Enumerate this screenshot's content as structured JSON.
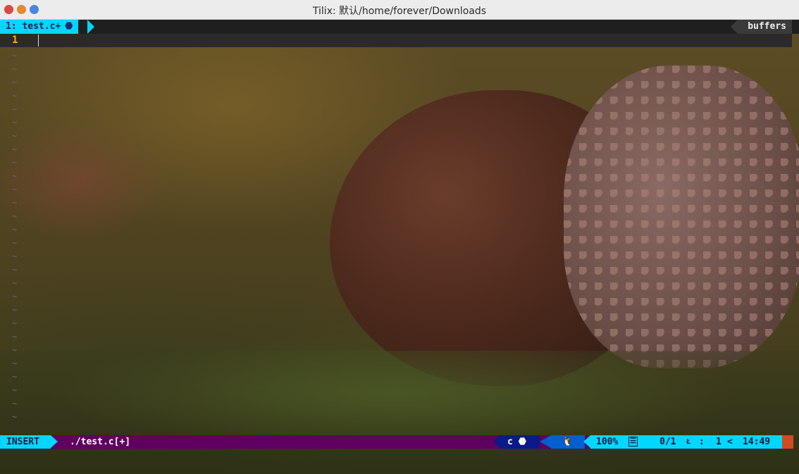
{
  "window": {
    "title": "Tilix: 默认/home/forever/Downloads"
  },
  "tabline": {
    "active_tab": "1: test.c+",
    "buffers_label": "buffers"
  },
  "editor": {
    "line_number": "1",
    "empty_line_marker": "~"
  },
  "statusline": {
    "mode": "INSERT",
    "file": "./test.c[+]",
    "filetype": "c",
    "percent": "100%",
    "errors": "0/1",
    "line_label": "1",
    "time": "14:49"
  },
  "colors": {
    "accent_cyan": "#00d7ff",
    "status_purple": "#5f005f",
    "line_number": "#ffaf00"
  }
}
